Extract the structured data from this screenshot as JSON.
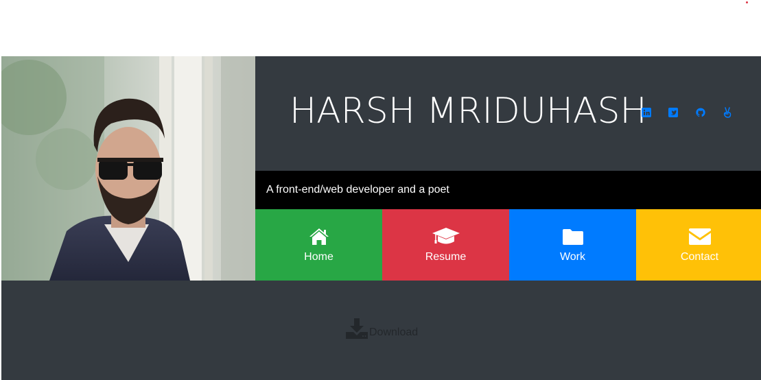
{
  "profile": {
    "name": "HARSH MRIDUHASH",
    "tagline": "A front-end/web developer and a poet",
    "photo_alt": "Harsh Mriduhash"
  },
  "social": [
    {
      "icon": "linkedin-icon",
      "name": "linkedin"
    },
    {
      "icon": "twitter-icon",
      "name": "twitter"
    },
    {
      "icon": "github-icon",
      "name": "github"
    },
    {
      "icon": "angellist-icon",
      "name": "angellist"
    }
  ],
  "nav": [
    {
      "label": "Home",
      "icon": "home-icon",
      "color": "#28a745"
    },
    {
      "label": "Resume",
      "icon": "graduation-cap-icon",
      "color": "#dc3545"
    },
    {
      "label": "Work",
      "icon": "folder-icon",
      "color": "#007bff"
    },
    {
      "label": "Contact",
      "icon": "envelope-icon",
      "color": "#ffc107"
    }
  ],
  "download": {
    "label": "Download",
    "icon": "download-icon"
  },
  "colors": {
    "page_bg": "#ffffff",
    "card_bg": "#343a40",
    "tagline_bg": "#000000",
    "social_icon": "#007bff",
    "download_text": "#23272b"
  }
}
